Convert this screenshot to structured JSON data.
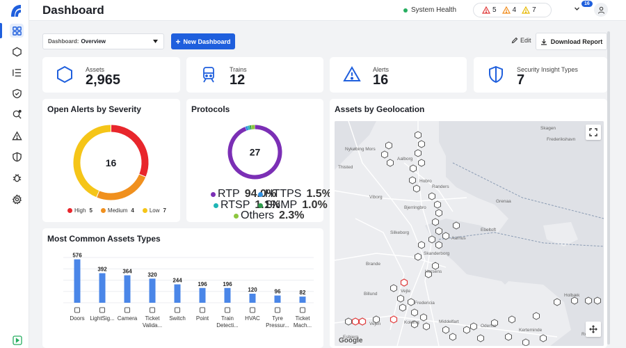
{
  "header": {
    "title": "Dashboard",
    "system_health": "System Health",
    "alerts": [
      {
        "icon": "warning-red-icon",
        "color": "#e03a3a",
        "count": "5"
      },
      {
        "icon": "warning-orange-icon",
        "color": "#f08c1c",
        "count": "4"
      },
      {
        "icon": "warning-yellow-icon",
        "color": "#e6b800",
        "count": "7"
      }
    ],
    "notification_badge": "16"
  },
  "sidebar": {
    "items": [
      "dashboard-icon",
      "assets-icon",
      "list-icon",
      "shield-check-icon",
      "search-insight-icon",
      "alert-icon",
      "security-shield-icon",
      "bug-icon",
      "settings-icon"
    ]
  },
  "toolbar": {
    "select_prefix": "Dashboard:",
    "select_value": "Overview",
    "new_dashboard": "New Dashboard",
    "edit": "Edit",
    "download": "Download Report"
  },
  "stats": [
    {
      "label": "Assets",
      "value": "2,965",
      "icon": "hexagon-icon"
    },
    {
      "label": "Trains",
      "value": "12",
      "icon": "train-icon"
    },
    {
      "label": "Alerts",
      "value": "16",
      "icon": "alert-triangle-icon"
    },
    {
      "label": "Security Insight Types",
      "value": "7",
      "icon": "shield-icon"
    }
  ],
  "severity": {
    "title": "Open Alerts by Severity",
    "total": "16",
    "segments": [
      {
        "label": "High",
        "value": 5,
        "color": "#e8262c"
      },
      {
        "label": "Medium",
        "value": 4,
        "color": "#f0901e"
      },
      {
        "label": "Low",
        "value": 7,
        "color": "#f5c518"
      }
    ]
  },
  "protocols": {
    "title": "Protocols",
    "total": "27",
    "items": [
      {
        "label": "RTP",
        "pct": "94.0%",
        "value": 94.0,
        "color": "#7b2fb5"
      },
      {
        "label": "HTTPS",
        "pct": "1.5%",
        "value": 1.5,
        "color": "#2f8fe0"
      },
      {
        "label": "RTSP",
        "pct": "1.1%",
        "value": 1.1,
        "color": "#1fb5b5"
      },
      {
        "label": "SNMP",
        "pct": "1.0%",
        "value": 1.0,
        "color": "#2e9b4b"
      },
      {
        "label": "Others",
        "pct": "2.3%",
        "value": 2.3,
        "color": "#8dc63f"
      }
    ]
  },
  "geo": {
    "title": "Assets by Geolocation",
    "attribution": "Google",
    "places": [
      "Skagen",
      "Frederikshavn",
      "Nykøbing Mors",
      "Thisted",
      "Aalborg",
      "Hobro",
      "Randers",
      "Viborg",
      "Bjerringbro",
      "Grenaa",
      "Ebeltoft",
      "Silkeborg",
      "Aarhus",
      "Skanderborg",
      "Horsens",
      "Brande",
      "Vejle",
      "Billund",
      "Fredericia",
      "Middelfart",
      "Kolding",
      "Odense",
      "Vejen",
      "Esbjerg",
      "Kerteminde",
      "Holbæk",
      "Roskilde"
    ]
  },
  "asset_types": {
    "title": "Most Common Assets Types",
    "chart_data": {
      "type": "bar",
      "categories": [
        "Doors",
        "LightSig...",
        "Camera",
        "Ticket Valida...",
        "Switch",
        "Point",
        "Train Detecti...",
        "HVAC",
        "Tyre Pressur...",
        "Ticket Mach..."
      ],
      "values": [
        576,
        392,
        364,
        320,
        244,
        196,
        196,
        120,
        96,
        82
      ],
      "icons": [
        "door-icon",
        "light-signal-icon",
        "camera-icon",
        "ticket-validator-icon",
        "switch-icon",
        "point-icon",
        "train-detection-icon",
        "hvac-icon",
        "tyre-pressure-icon",
        "ticket-machine-icon"
      ],
      "color": "#4a86e8",
      "ylim": [
        0,
        600
      ],
      "grid": true
    }
  }
}
